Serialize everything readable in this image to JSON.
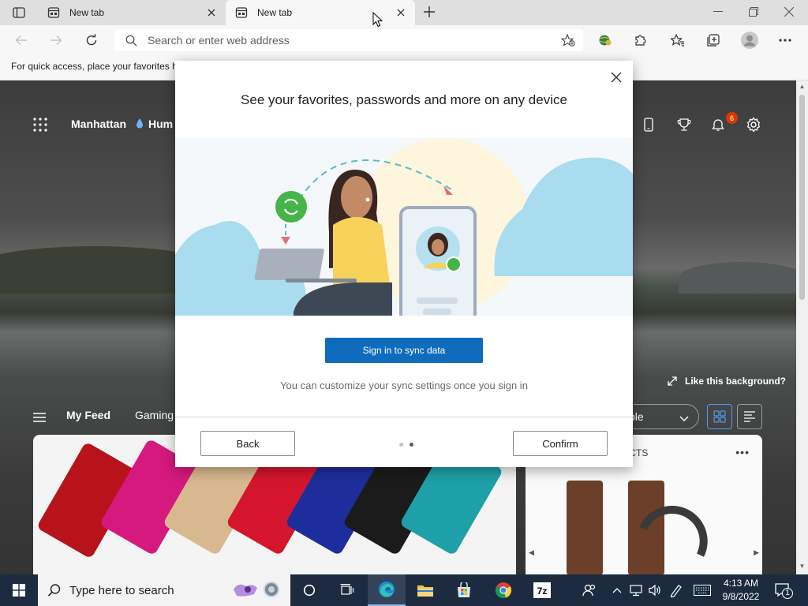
{
  "browser": {
    "tabs": [
      {
        "label": "New tab",
        "active": false
      },
      {
        "label": "New tab",
        "active": true
      }
    ],
    "address": {
      "placeholder": "Search or enter web address"
    },
    "favorites_bar_text": "For quick access, place your favorites h"
  },
  "page": {
    "location": "Manhattan",
    "weather": "Hum",
    "notification_count": "6",
    "like_background": "Like this background?",
    "feed_tabs": [
      "My Feed",
      "Gaming"
    ],
    "layout_select_value": "ble",
    "card_right_label": "ICTS"
  },
  "modal": {
    "title": "See your favorites, passwords and more on any device",
    "primary_button": "Sign in to sync data",
    "note": "You can customize your sync settings once you sign in",
    "back_button": "Back",
    "confirm_button": "Confirm",
    "steps_total": 2,
    "step_current": 2
  },
  "taskbar": {
    "search_placeholder": "Type here to search",
    "time": "4:13 AM",
    "date": "9/8/2022",
    "notification_count": "1"
  },
  "colors": {
    "accent": "#0f6cbd",
    "badge": "#d83b01",
    "taskbar": "#1c2b3f"
  }
}
